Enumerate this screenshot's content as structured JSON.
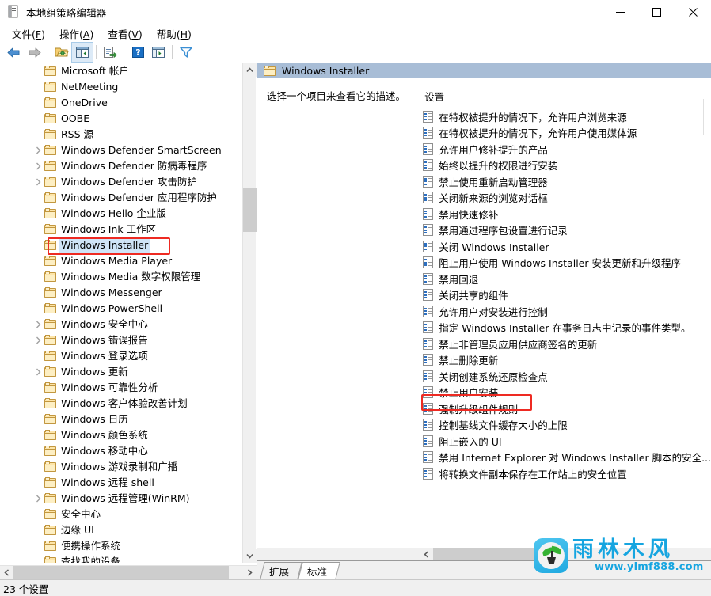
{
  "window": {
    "title": "本地组策略编辑器",
    "icon": "policy-editor-icon",
    "minimize_label": "最小化",
    "maximize_label": "最大化",
    "close_label": "关闭"
  },
  "menubar": {
    "items": [
      {
        "label": "文件(F)",
        "text": "文件",
        "accel": "F"
      },
      {
        "label": "操作(A)",
        "text": "操作",
        "accel": "A"
      },
      {
        "label": "查看(V)",
        "text": "查看",
        "accel": "V"
      },
      {
        "label": "帮助(H)",
        "text": "帮助",
        "accel": "H"
      }
    ]
  },
  "toolbar": {
    "buttons": [
      {
        "name": "back-arrow-icon"
      },
      {
        "name": "forward-arrow-icon"
      },
      {
        "name": "up-folder-icon"
      },
      {
        "name": "show-hide-tree-icon"
      },
      {
        "name": "export-list-icon"
      },
      {
        "name": "help-icon"
      },
      {
        "name": "properties-icon"
      },
      {
        "name": "filter-icon"
      }
    ]
  },
  "tree": {
    "items": [
      {
        "label": "Microsoft 帐户",
        "expandable": false
      },
      {
        "label": "NetMeeting",
        "expandable": false
      },
      {
        "label": "OneDrive",
        "expandable": false
      },
      {
        "label": "OOBE",
        "expandable": false
      },
      {
        "label": "RSS 源",
        "expandable": false
      },
      {
        "label": "Windows Defender SmartScreen",
        "expandable": true
      },
      {
        "label": "Windows Defender 防病毒程序",
        "expandable": true
      },
      {
        "label": "Windows Defender 攻击防护",
        "expandable": true
      },
      {
        "label": "Windows Defender 应用程序防护",
        "expandable": false
      },
      {
        "label": "Windows Hello 企业版",
        "expandable": false
      },
      {
        "label": "Windows Ink 工作区",
        "expandable": false
      },
      {
        "label": "Windows Installer",
        "expandable": false,
        "selected": true,
        "highlighted": true
      },
      {
        "label": "Windows Media Player",
        "expandable": false
      },
      {
        "label": "Windows Media 数字权限管理",
        "expandable": false
      },
      {
        "label": "Windows Messenger",
        "expandable": false
      },
      {
        "label": "Windows PowerShell",
        "expandable": false
      },
      {
        "label": "Windows 安全中心",
        "expandable": true
      },
      {
        "label": "Windows 错误报告",
        "expandable": true
      },
      {
        "label": "Windows 登录选项",
        "expandable": false
      },
      {
        "label": "Windows 更新",
        "expandable": true
      },
      {
        "label": "Windows 可靠性分析",
        "expandable": false
      },
      {
        "label": "Windows 客户体验改善计划",
        "expandable": false
      },
      {
        "label": "Windows 日历",
        "expandable": false
      },
      {
        "label": "Windows 颜色系统",
        "expandable": false
      },
      {
        "label": "Windows 移动中心",
        "expandable": false
      },
      {
        "label": "Windows 游戏录制和广播",
        "expandable": false
      },
      {
        "label": "Windows 远程 shell",
        "expandable": false
      },
      {
        "label": "Windows 远程管理(WinRM)",
        "expandable": true
      },
      {
        "label": "安全中心",
        "expandable": false
      },
      {
        "label": "边缘 UI",
        "expandable": false
      },
      {
        "label": "便携操作系统",
        "expandable": false
      },
      {
        "label": "查找我的设备",
        "expandable": false
      }
    ]
  },
  "right_panel": {
    "header": "Windows Installer",
    "description": "选择一个项目来查看它的描述。",
    "column_header": "设置",
    "settings": [
      {
        "label": "在特权被提升的情况下，允许用户浏览来源"
      },
      {
        "label": "在特权被提升的情况下，允许用户使用媒体源"
      },
      {
        "label": "允许用户修补提升的产品"
      },
      {
        "label": "始终以提升的权限进行安装"
      },
      {
        "label": "禁止使用重新启动管理器"
      },
      {
        "label": "关闭新来源的浏览对话框"
      },
      {
        "label": "禁用快速修补"
      },
      {
        "label": "禁用通过程序包设置进行记录"
      },
      {
        "label": "关闭 Windows Installer"
      },
      {
        "label": "阻止用户使用 Windows Installer 安装更新和升级程序"
      },
      {
        "label": "禁用回退"
      },
      {
        "label": "关闭共享的组件"
      },
      {
        "label": "允许用户对安装进行控制"
      },
      {
        "label": "指定 Windows Installer 在事务日志中记录的事件类型。"
      },
      {
        "label": "禁止非管理员应用供应商签名的更新"
      },
      {
        "label": "禁止删除更新"
      },
      {
        "label": "关闭创建系统还原检查点"
      },
      {
        "label": "禁止用户安装",
        "highlighted": true
      },
      {
        "label": "强制升级组件规则"
      },
      {
        "label": "控制基线文件缓存大小的上限"
      },
      {
        "label": "阻止嵌入的 UI"
      },
      {
        "label": "禁用 Internet Explorer 对 Windows Installer 脚本的安全..."
      },
      {
        "label": "将转换文件副本保存在工作站上的安全位置"
      }
    ],
    "tabs": [
      {
        "label": "扩展",
        "active": false
      },
      {
        "label": "标准",
        "active": true
      }
    ]
  },
  "statusbar": {
    "text": "23 个设置"
  },
  "watermark": {
    "brand": "雨林木风",
    "url": "www.ylmf888.com"
  },
  "colors": {
    "header_blue": "#a8bdd6",
    "selection_blue": "#cfe4f7",
    "highlight_red": "#ee2a22",
    "watermark_blue": "#16a5e0"
  }
}
